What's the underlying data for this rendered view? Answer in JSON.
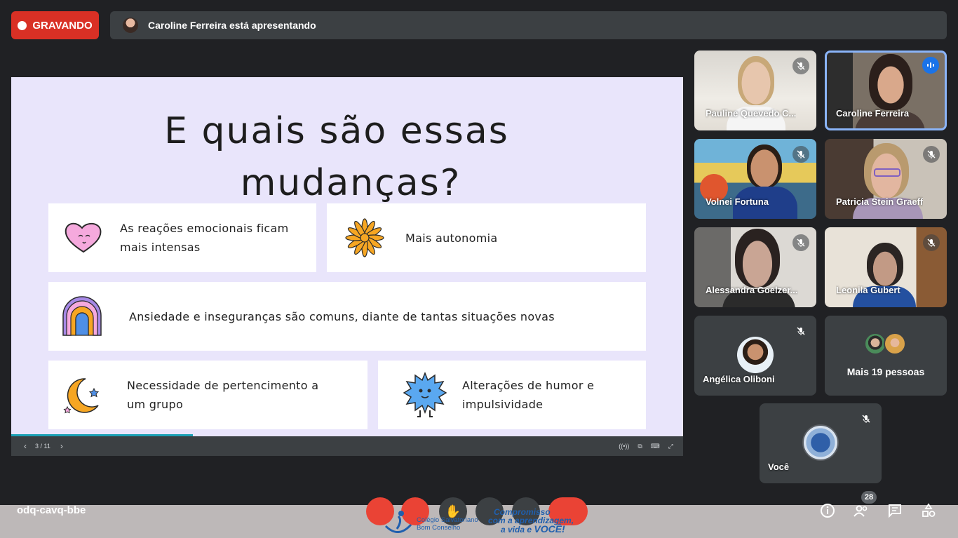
{
  "recording": {
    "label": "GRAVANDO"
  },
  "presenting": {
    "text": "Caroline Ferreira está apresentando"
  },
  "slide": {
    "title_line1": "E quais são essas",
    "title_line2": "mudanças?",
    "cards": [
      {
        "text": "As reações emocionais ficam mais intensas",
        "icon": "heart-icon"
      },
      {
        "text": "Mais autonomia",
        "icon": "flower-icon"
      },
      {
        "text": "Ansiedade e inseguranças são comuns, diante de tantas situações novas",
        "icon": "rainbow-icon"
      },
      {
        "text": "Necessidade de pertencimento a um grupo",
        "icon": "moon-icon"
      },
      {
        "text": "Alterações de humor e impulsividade",
        "icon": "spiky-monster-icon"
      }
    ],
    "page_indicator": "3 / 11",
    "progress": 0.27
  },
  "participants": [
    {
      "name": "Pauline Quevedo C...",
      "muted": true
    },
    {
      "name": "Caroline Ferreira",
      "speaking": true
    },
    {
      "name": "Volnei Fortuna",
      "muted": true
    },
    {
      "name": "Patricia Stein Graeff",
      "muted": true
    },
    {
      "name": "Alessandra Goelzer...",
      "muted": true
    },
    {
      "name": "Leonila Gubert",
      "muted": true
    },
    {
      "name": "Angélica Oliboni",
      "muted": true
    }
  ],
  "more_people": "Mais 19 pessoas",
  "self_tile": {
    "name": "Você"
  },
  "meeting_code": "odq-cavq-bbe",
  "participant_count": "28",
  "banner": {
    "school_line1": "Colégio Salvatoriano",
    "school_line2": "Bom Conselho",
    "slogan_line1": "Compromisso",
    "slogan_line2": "com a aprendizagem,",
    "slogan_line3": "a vida e",
    "slogan_emphasis": "VOCÊ!"
  },
  "colors": {
    "record_red": "#d93025",
    "slide_bg": "#e9e5fb",
    "speaking_blue": "#8ab4f8",
    "progress": "#1aa1b5",
    "bottom_bar": "#bdb8b8"
  }
}
